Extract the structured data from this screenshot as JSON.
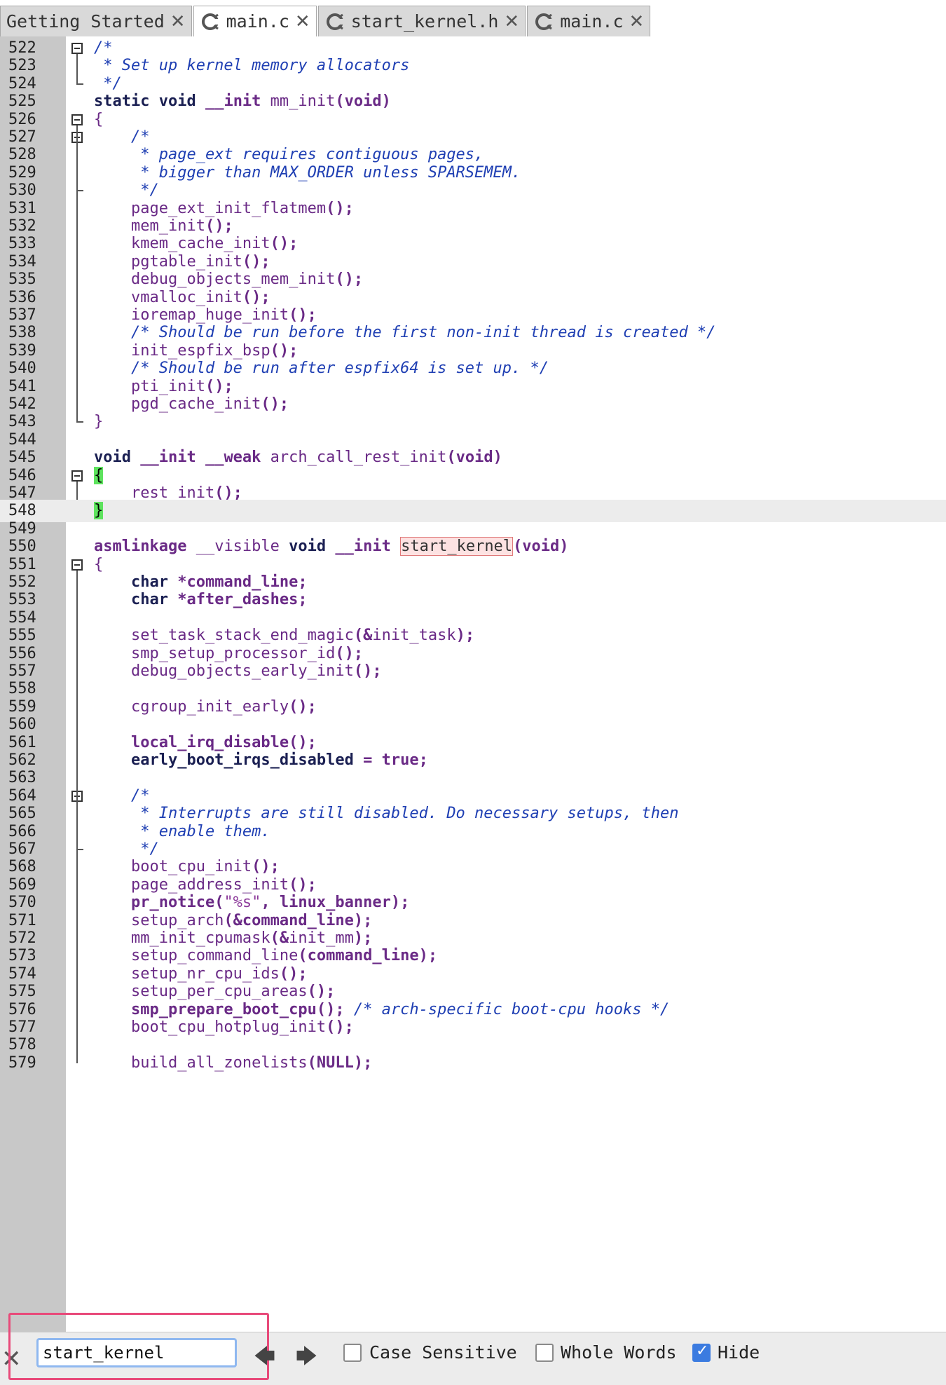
{
  "tabs": [
    {
      "label": "Getting Started",
      "icon": "none",
      "active": false
    },
    {
      "label": "main.c",
      "icon": "c-source-icon",
      "active": true
    },
    {
      "label": "start_kernel.h",
      "icon": "c-source-icon",
      "active": false
    },
    {
      "label": "main.c",
      "icon": "c-source-icon",
      "active": false
    }
  ],
  "close_glyph": "✕",
  "lines": [
    {
      "n": "522",
      "t": [
        [
          "c",
          "/*"
        ]
      ]
    },
    {
      "n": "523",
      "t": [
        [
          "c",
          " * Set up kernel memory allocators"
        ]
      ]
    },
    {
      "n": "524",
      "t": [
        [
          "c",
          " */"
        ]
      ]
    },
    {
      "n": "525",
      "t": [
        [
          "k",
          "static void "
        ],
        [
          "k2",
          "__init "
        ],
        [
          "p",
          "mm_init"
        ],
        [
          "s",
          "(void)"
        ]
      ]
    },
    {
      "n": "526",
      "t": [
        [
          "p",
          "{"
        ]
      ]
    },
    {
      "n": "527",
      "t": [
        [
          "c",
          "    /*"
        ]
      ]
    },
    {
      "n": "528",
      "t": [
        [
          "c",
          "     * page_ext requires contiguous pages,"
        ]
      ]
    },
    {
      "n": "529",
      "t": [
        [
          "c",
          "     * bigger than MAX_ORDER unless SPARSEMEM."
        ]
      ]
    },
    {
      "n": "530",
      "t": [
        [
          "c",
          "     */"
        ]
      ]
    },
    {
      "n": "531",
      "t": [
        [
          "p",
          "    page_ext_init_flatmem"
        ],
        [
          "s",
          "();"
        ]
      ]
    },
    {
      "n": "532",
      "t": [
        [
          "p",
          "    mem_init"
        ],
        [
          "s",
          "();"
        ]
      ]
    },
    {
      "n": "533",
      "t": [
        [
          "p",
          "    kmem_cache_init"
        ],
        [
          "s",
          "();"
        ]
      ]
    },
    {
      "n": "534",
      "t": [
        [
          "p",
          "    pgtable_init"
        ],
        [
          "s",
          "();"
        ]
      ]
    },
    {
      "n": "535",
      "t": [
        [
          "p",
          "    debug_objects_mem_init"
        ],
        [
          "s",
          "();"
        ]
      ]
    },
    {
      "n": "536",
      "t": [
        [
          "p",
          "    vmalloc_init"
        ],
        [
          "s",
          "();"
        ]
      ]
    },
    {
      "n": "537",
      "t": [
        [
          "p",
          "    ioremap_huge_init"
        ],
        [
          "s",
          "();"
        ]
      ]
    },
    {
      "n": "538",
      "t": [
        [
          "c",
          "    /* Should be run before the first non-init thread is created */"
        ]
      ]
    },
    {
      "n": "539",
      "t": [
        [
          "p",
          "    init_espfix_bsp"
        ],
        [
          "s",
          "();"
        ]
      ]
    },
    {
      "n": "540",
      "t": [
        [
          "c",
          "    /* Should be run after espfix64 is set up. */"
        ]
      ]
    },
    {
      "n": "541",
      "t": [
        [
          "p",
          "    pti_init"
        ],
        [
          "s",
          "();"
        ]
      ]
    },
    {
      "n": "542",
      "t": [
        [
          "p",
          "    pgd_cache_init"
        ],
        [
          "s",
          "();"
        ]
      ]
    },
    {
      "n": "543",
      "t": [
        [
          "p",
          "}"
        ]
      ]
    },
    {
      "n": "544",
      "t": []
    },
    {
      "n": "545",
      "t": [
        [
          "k",
          "void "
        ],
        [
          "k2",
          "__init __weak "
        ],
        [
          "p",
          "arch_call_rest_init"
        ],
        [
          "s",
          "(void)"
        ]
      ]
    },
    {
      "n": "546",
      "t": [
        [
          "b",
          "{"
        ]
      ]
    },
    {
      "n": "547",
      "t": [
        [
          "p",
          "    rest_init"
        ],
        [
          "s",
          "();"
        ]
      ]
    },
    {
      "n": "548",
      "t": [
        [
          "b",
          "}"
        ]
      ],
      "current": true
    },
    {
      "n": "549",
      "t": []
    },
    {
      "n": "550",
      "t": [
        [
          "k2",
          "asmlinkage "
        ],
        [
          "p",
          "__visible "
        ],
        [
          "k",
          "void "
        ],
        [
          "k2",
          "__init "
        ],
        [
          "h",
          "start_kernel"
        ],
        [
          "s",
          "(void)"
        ]
      ]
    },
    {
      "n": "551",
      "t": [
        [
          "p",
          "{"
        ]
      ]
    },
    {
      "n": "552",
      "t": [
        [
          "k",
          "    char "
        ],
        [
          "s",
          "*command_line;"
        ]
      ]
    },
    {
      "n": "553",
      "t": [
        [
          "k",
          "    char "
        ],
        [
          "s",
          "*after_dashes;"
        ]
      ]
    },
    {
      "n": "554",
      "t": []
    },
    {
      "n": "555",
      "t": [
        [
          "p",
          "    set_task_stack_end_magic"
        ],
        [
          "s",
          "(&"
        ],
        [
          "p",
          "init_task"
        ],
        [
          "s",
          ");"
        ]
      ]
    },
    {
      "n": "556",
      "t": [
        [
          "p",
          "    smp_setup_processor_id"
        ],
        [
          "s",
          "();"
        ]
      ]
    },
    {
      "n": "557",
      "t": [
        [
          "p",
          "    debug_objects_early_init"
        ],
        [
          "s",
          "();"
        ]
      ]
    },
    {
      "n": "558",
      "t": []
    },
    {
      "n": "559",
      "t": [
        [
          "p",
          "    cgroup_init_early"
        ],
        [
          "s",
          "();"
        ]
      ]
    },
    {
      "n": "560",
      "t": []
    },
    {
      "n": "561",
      "t": [
        [
          "k2",
          "    local_irq_disable"
        ],
        [
          "s",
          "();"
        ]
      ]
    },
    {
      "n": "562",
      "t": [
        [
          "k",
          "    early_boot_irqs_disabled "
        ],
        [
          "s",
          "= "
        ],
        [
          "k2",
          "true"
        ],
        [
          "s",
          ";"
        ]
      ]
    },
    {
      "n": "563",
      "t": []
    },
    {
      "n": "564",
      "t": [
        [
          "c",
          "    /*"
        ]
      ]
    },
    {
      "n": "565",
      "t": [
        [
          "c",
          "     * Interrupts are still disabled. Do necessary setups, then"
        ]
      ]
    },
    {
      "n": "566",
      "t": [
        [
          "c",
          "     * enable them."
        ]
      ]
    },
    {
      "n": "567",
      "t": [
        [
          "c",
          "     */"
        ]
      ]
    },
    {
      "n": "568",
      "t": [
        [
          "p",
          "    boot_cpu_init"
        ],
        [
          "s",
          "();"
        ]
      ]
    },
    {
      "n": "569",
      "t": [
        [
          "p",
          "    page_address_init"
        ],
        [
          "s",
          "();"
        ]
      ]
    },
    {
      "n": "570",
      "t": [
        [
          "k2",
          "    pr_notice"
        ],
        [
          "s",
          "("
        ],
        [
          "r",
          "\"%s\""
        ],
        [
          "s",
          ", linux_banner);"
        ]
      ]
    },
    {
      "n": "571",
      "t": [
        [
          "p",
          "    setup_arch"
        ],
        [
          "s",
          "(&command_line);"
        ]
      ]
    },
    {
      "n": "572",
      "t": [
        [
          "p",
          "    mm_init_cpumask"
        ],
        [
          "s",
          "(&"
        ],
        [
          "p",
          "init_mm"
        ],
        [
          "s",
          ");"
        ]
      ]
    },
    {
      "n": "573",
      "t": [
        [
          "p",
          "    setup_command_line"
        ],
        [
          "s",
          "(command_line);"
        ]
      ]
    },
    {
      "n": "574",
      "t": [
        [
          "p",
          "    setup_nr_cpu_ids"
        ],
        [
          "s",
          "();"
        ]
      ]
    },
    {
      "n": "575",
      "t": [
        [
          "p",
          "    setup_per_cpu_areas"
        ],
        [
          "s",
          "();"
        ]
      ]
    },
    {
      "n": "576",
      "t": [
        [
          "k2",
          "    smp_prepare_boot_cpu"
        ],
        [
          "s",
          "(); "
        ],
        [
          "c",
          "/* arch-specific boot-cpu hooks */"
        ]
      ]
    },
    {
      "n": "577",
      "t": [
        [
          "p",
          "    boot_cpu_hotplug_init"
        ],
        [
          "s",
          "();"
        ]
      ]
    },
    {
      "n": "578",
      "t": []
    },
    {
      "n": "579",
      "t": [
        [
          "p",
          "    build_all_zonelists"
        ],
        [
          "s",
          "(NULL);"
        ]
      ]
    }
  ],
  "folds": {
    "boxes": [
      "522",
      "526",
      "527",
      "546",
      "551",
      "564"
    ],
    "ends": [
      "524",
      "530",
      "543",
      "548",
      "567"
    ]
  },
  "find": {
    "value": "start_kernel",
    "close_glyph": "✕",
    "prev_glyph": "🡄",
    "next_glyph": "🡆",
    "case_sensitive_label": "Case Sensitive",
    "case_sensitive": false,
    "whole_words_label": "Whole Words",
    "whole_words": false,
    "hide_label": "Hide",
    "hide": true
  }
}
